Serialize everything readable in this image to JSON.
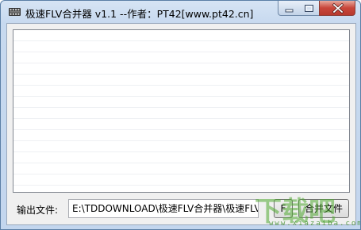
{
  "window": {
    "title": "极速FLV合并器 v1.1 --作者：PT42[www.pt42.cn]",
    "icon": "film-strip-icon"
  },
  "controls": {
    "minimize": "minimize-icon",
    "maximize": "maximize-icon",
    "close": "close-icon"
  },
  "output": {
    "label": "输出文件:",
    "path": "E:\\TDDOWNLOAD\\极速FLV合并器\\极速FLV",
    "browse_label": "F",
    "merge_label": "合并文件"
  },
  "watermark": {
    "main": "下载吧",
    "sub": "www.xiazaiba.com"
  },
  "colors": {
    "title_bar": "#c7d9ef",
    "close_button": "#c8463a",
    "client_bg": "#f0f0f0"
  }
}
